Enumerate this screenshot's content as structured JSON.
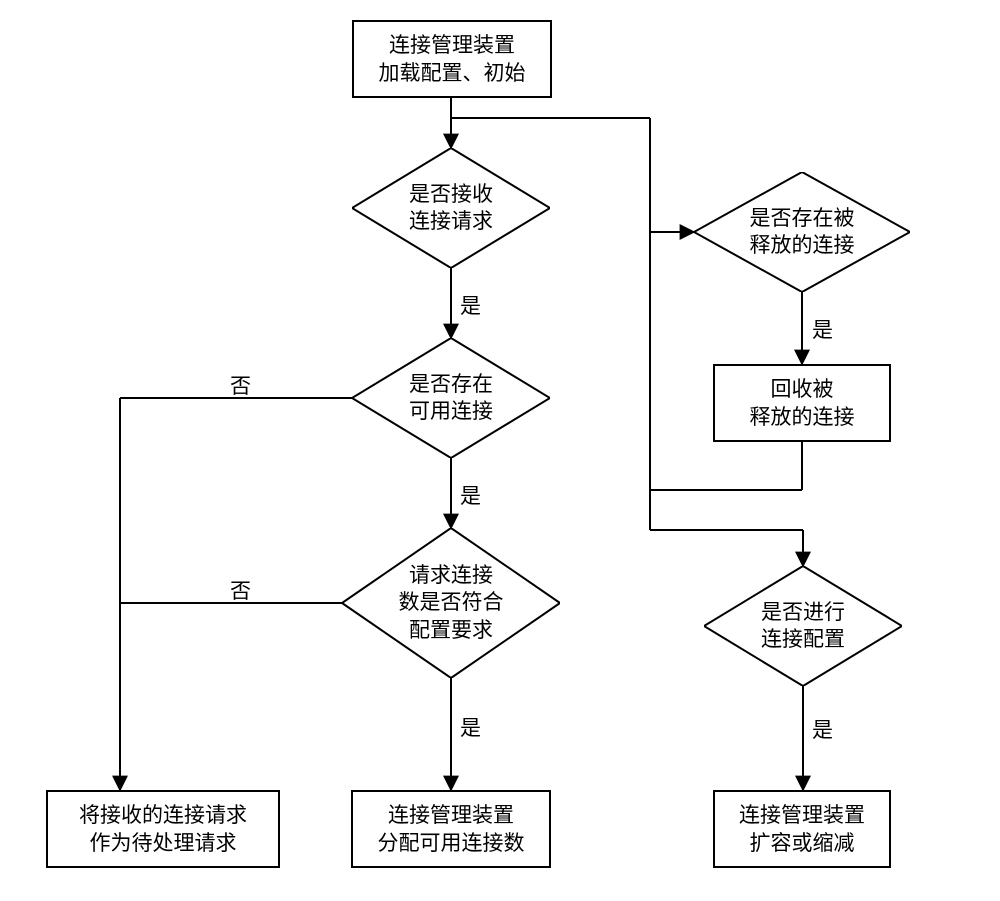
{
  "nodes": {
    "start": {
      "line1": "连接管理装置",
      "line2": "加载配置、初始"
    },
    "d1": {
      "line1": "是否接收",
      "line2": "连接请求"
    },
    "d2": {
      "line1": "是否存在",
      "line2": "可用连接"
    },
    "d3": {
      "line1": "请求连接",
      "line2": "数是否符合",
      "line3": "配置要求"
    },
    "p_left": {
      "line1": "将接收的连接请求",
      "line2": "作为待处理请求"
    },
    "p_mid": {
      "line1": "连接管理装置",
      "line2": "分配可用连接数"
    },
    "d4": {
      "line1": "是否存在被",
      "line2": "释放的连接"
    },
    "p_recover": {
      "line1": "回收被",
      "line2": "释放的连接"
    },
    "d5": {
      "line1": "是否进行",
      "line2": "连接配置"
    },
    "p_scale": {
      "line1": "连接管理装置",
      "line2": "扩容或缩减"
    }
  },
  "labels": {
    "yes": "是",
    "no": "否"
  }
}
